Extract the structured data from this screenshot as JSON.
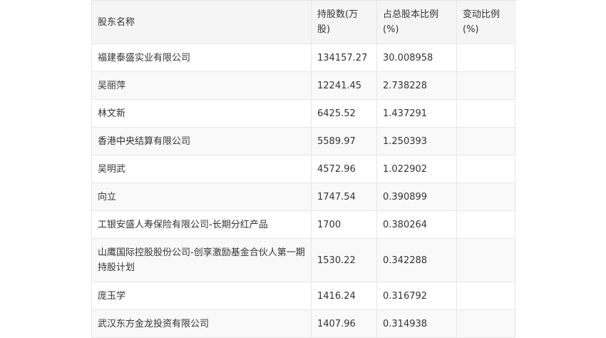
{
  "table": {
    "headers": [
      "股东名称",
      "持股数(万股)",
      "占总股本比例(%)",
      "变动比例(%)"
    ],
    "rows": [
      [
        "福建泰盛实业有限公司",
        "134157.27",
        "30.008958",
        ""
      ],
      [
        "吴丽萍",
        "12241.45",
        "2.738228",
        ""
      ],
      [
        "林文新",
        "6425.52",
        "1.437291",
        ""
      ],
      [
        "香港中央结算有限公司",
        "5589.97",
        "1.250393",
        ""
      ],
      [
        "吴明武",
        "4572.96",
        "1.022902",
        ""
      ],
      [
        "向立",
        "1747.54",
        "0.390899",
        ""
      ],
      [
        "工银安盛人寿保险有限公司-长期分红产品",
        "1700",
        "0.380264",
        ""
      ],
      [
        "山鹰国际控股股份公司-创享激励基金合伙人第一期持股计划",
        "1530.22",
        "0.342288",
        ""
      ],
      [
        "庞玉学",
        "1416.24",
        "0.316792",
        ""
      ],
      [
        "武汉东方金龙投资有限公司",
        "1407.96",
        "0.314938",
        ""
      ]
    ]
  }
}
